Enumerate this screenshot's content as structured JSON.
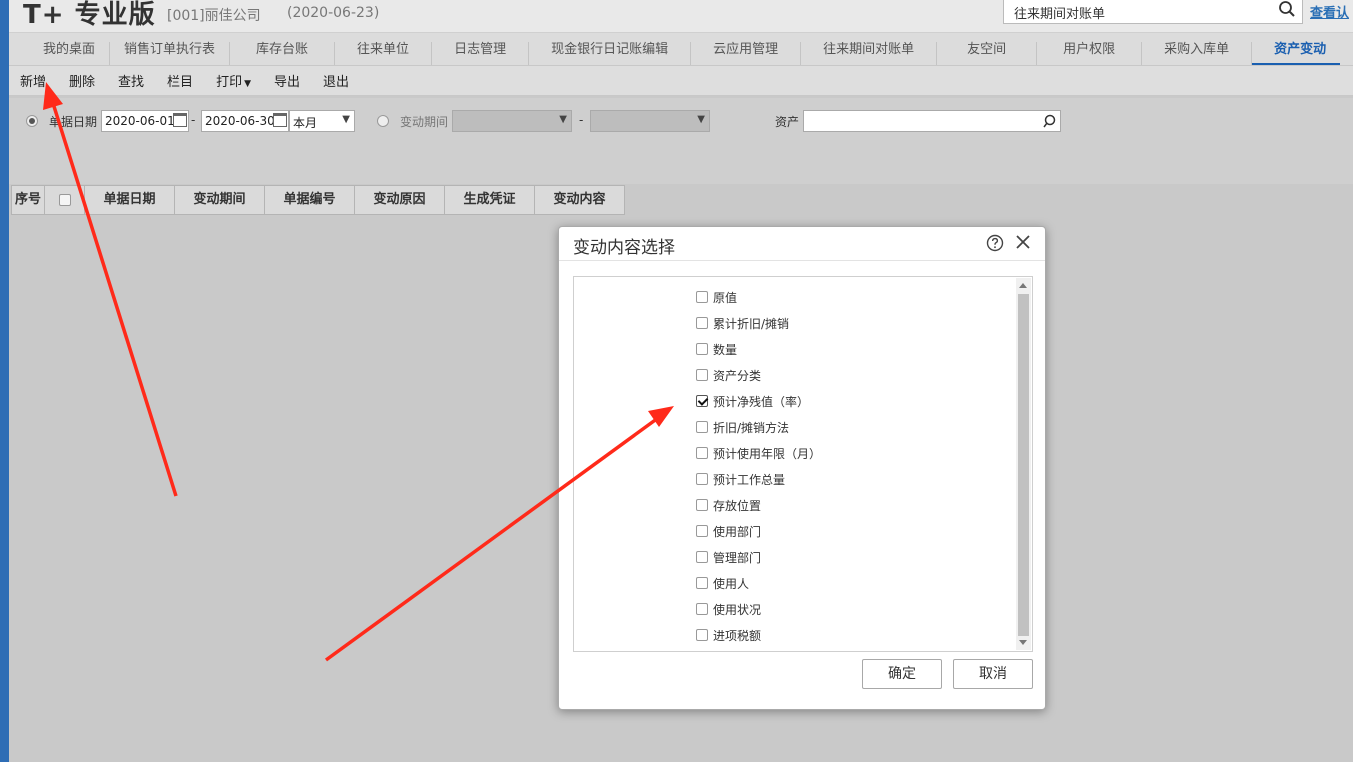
{
  "header": {
    "logo": "T+ 专业版",
    "company": "[001]丽佳公司",
    "date": "(2020-06-23)",
    "search_value": "往来期间对账单",
    "right_link": "查看认"
  },
  "tabs": [
    {
      "label": "我的桌面"
    },
    {
      "label": "销售订单执行表"
    },
    {
      "label": "库存台账"
    },
    {
      "label": "往来单位"
    },
    {
      "label": "日志管理"
    },
    {
      "label": "现金银行日记账编辑"
    },
    {
      "label": "云应用管理"
    },
    {
      "label": "往来期间对账单"
    },
    {
      "label": "友空间"
    },
    {
      "label": "用户权限"
    },
    {
      "label": "采购入库单"
    },
    {
      "label": "资产变动"
    }
  ],
  "toolbar": {
    "new": "新增",
    "delete": "删除",
    "find": "查找",
    "columns": "栏目",
    "print": "打印",
    "export": "导出",
    "exit": "退出"
  },
  "filter": {
    "doc_date_label": "单据日期",
    "date_from": "2020-06-01",
    "date_sep": "-",
    "date_to": "2020-06-30",
    "period_preset": "本月",
    "change_period_label": "变动期间",
    "period_sep": "-",
    "asset_label": "资产"
  },
  "grid": {
    "columns": [
      "序号",
      "",
      "单据日期",
      "变动期间",
      "单据编号",
      "变动原因",
      "生成凭证",
      "变动内容"
    ]
  },
  "dialog": {
    "title": "变动内容选择",
    "options": [
      {
        "label": "原值",
        "checked": false
      },
      {
        "label": "累计折旧/摊销",
        "checked": false
      },
      {
        "label": "数量",
        "checked": false
      },
      {
        "label": "资产分类",
        "checked": false
      },
      {
        "label": "预计净残值（率）",
        "checked": true
      },
      {
        "label": "折旧/摊销方法",
        "checked": false
      },
      {
        "label": "预计使用年限（月）",
        "checked": false
      },
      {
        "label": "预计工作总量",
        "checked": false
      },
      {
        "label": "存放位置",
        "checked": false
      },
      {
        "label": "使用部门",
        "checked": false
      },
      {
        "label": "管理部门",
        "checked": false
      },
      {
        "label": "使用人",
        "checked": false
      },
      {
        "label": "使用状况",
        "checked": false
      },
      {
        "label": "进项税额",
        "checked": false
      }
    ],
    "ok": "确定",
    "cancel": "取消"
  },
  "colors": {
    "accent": "#1a5fb0",
    "annotation_arrow": "#ff2a1a"
  }
}
